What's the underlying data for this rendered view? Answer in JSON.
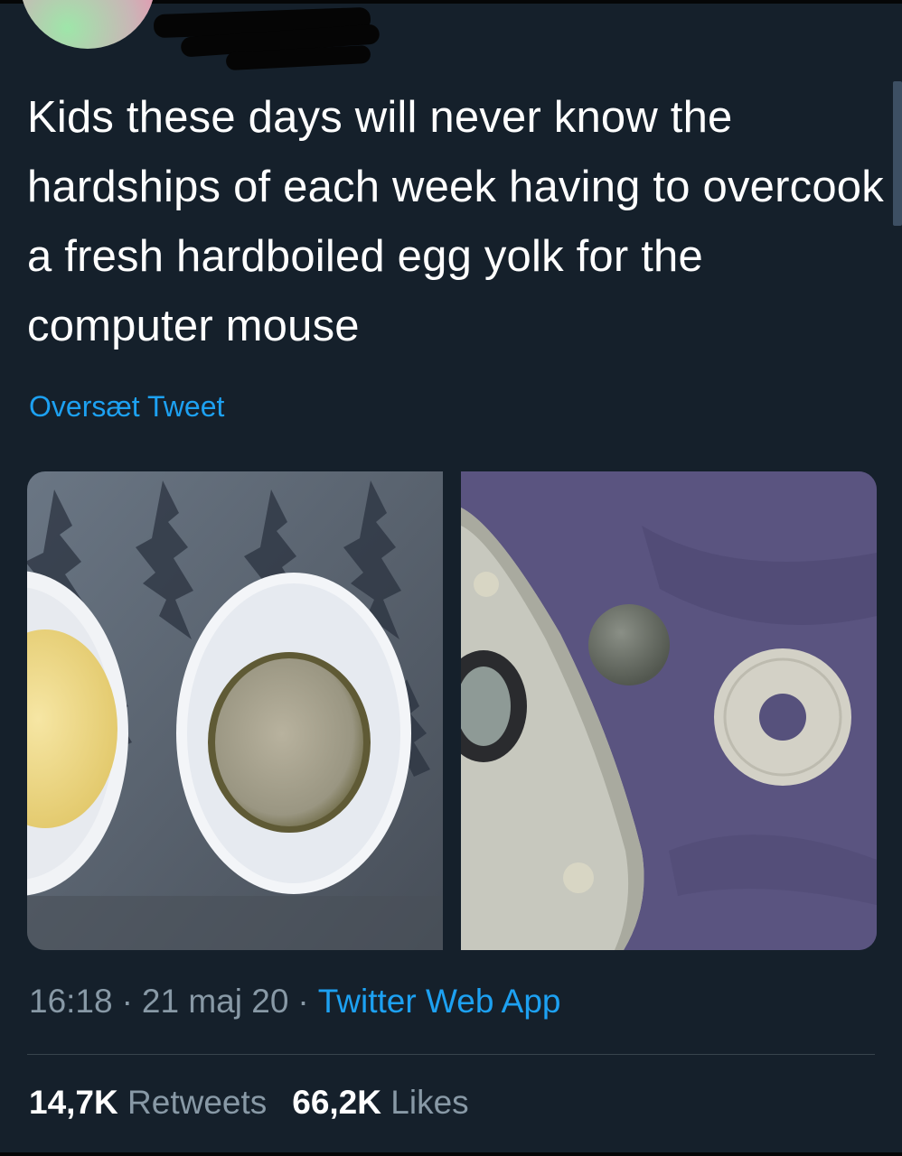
{
  "tweet": {
    "text": "Kids these days will never know the hardships of each week having to overcook a fresh hardboiled egg yolk for the computer mouse",
    "translate_label": "Oversæt Tweet",
    "time": "16:18",
    "date": "21 maj 20",
    "separator": "·",
    "source": "Twitter Web App",
    "retweets": {
      "count": "14,7K",
      "label": "Retweets"
    },
    "likes": {
      "count": "66,2K",
      "label": "Likes"
    }
  },
  "colors": {
    "background": "#15202b",
    "text": "#ffffff",
    "secondary_text": "#8899a6",
    "link": "#1da1f2",
    "divider": "#38444d"
  }
}
